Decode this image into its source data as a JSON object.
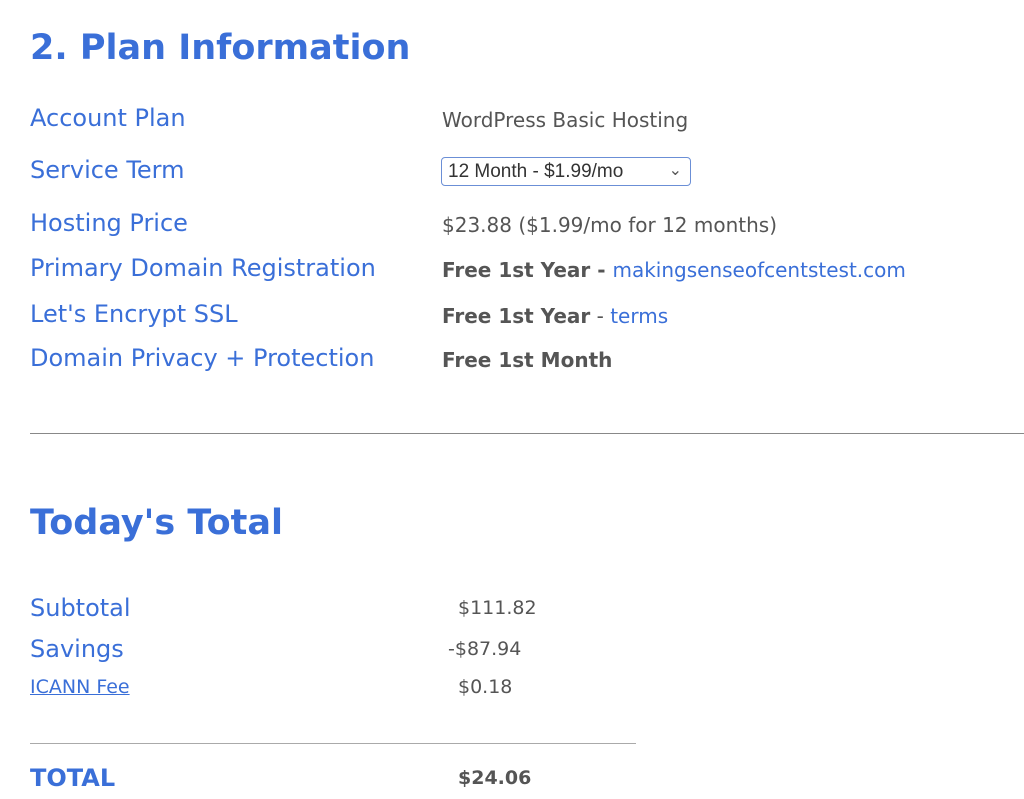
{
  "plan": {
    "title": "2. Plan Information",
    "account_plan": {
      "label": "Account Plan",
      "value": "WordPress Basic Hosting"
    },
    "service_term": {
      "label": "Service Term",
      "selected": "12 Month - $1.99/mo"
    },
    "hosting_price": {
      "label": "Hosting Price",
      "value": "$23.88 ($1.99/mo for 12 months)"
    },
    "primary_domain": {
      "label": "Primary Domain Registration",
      "value": "Free 1st Year - ",
      "link": "makingsenseofcentstest.com"
    },
    "ssl": {
      "label": "Let's Encrypt SSL",
      "value": "Free 1st Year",
      "separator": " - ",
      "link": "terms"
    },
    "privacy": {
      "label": "Domain Privacy + Protection",
      "value": "Free 1st Month"
    }
  },
  "total": {
    "title": "Today's Total",
    "subtotal": {
      "label": "Subtotal",
      "value": "$111.82"
    },
    "savings": {
      "label": "Savings",
      "value": "-$87.94"
    },
    "icann": {
      "label": "ICANN Fee",
      "value": "$0.18"
    },
    "grand": {
      "label": "TOTAL",
      "value": "$24.06"
    }
  },
  "colors": {
    "accent": "#3a6fd8",
    "text": "#555555"
  }
}
